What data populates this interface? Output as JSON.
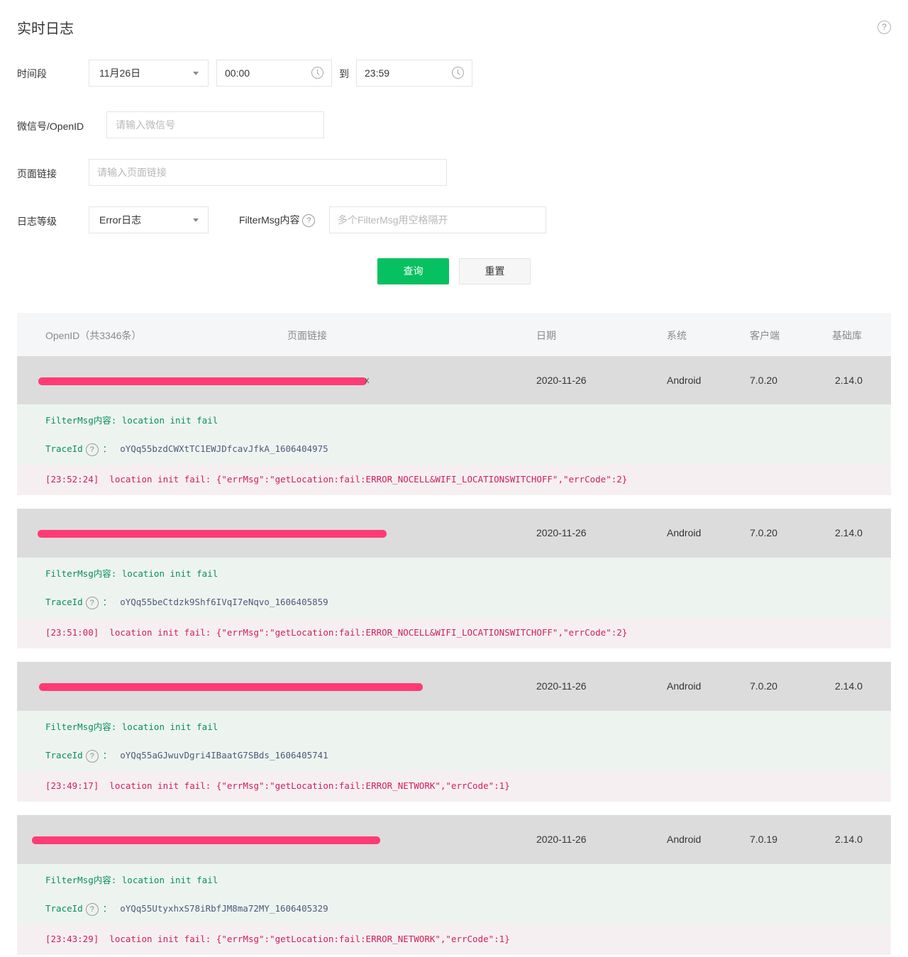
{
  "header": {
    "title": "实时日志",
    "help_icon": "question-circle-icon",
    "help_glyph": "?"
  },
  "filters": {
    "time_label": "时间段",
    "date_value": "11月26日",
    "start_time": "00:00",
    "to_label": "到",
    "end_time": "23:59",
    "wechat_label": "微信号/OpenID",
    "wechat_placeholder": "请输入微信号",
    "page_label": "页面链接",
    "page_placeholder": "请输入页面链接",
    "level_label": "日志等级",
    "level_value": "Error日志",
    "filtermsg_label": "FilterMsg内容",
    "filtermsg_placeholder": "多个FilterMsg用空格隔开",
    "query_button": "查询",
    "reset_button": "重置"
  },
  "table": {
    "columns": {
      "openid": "OpenID（共3346条）",
      "page": "页面链接",
      "date": "日期",
      "system": "系统",
      "client": "客户端",
      "lib": "基础库"
    },
    "trace_label": "TraceId",
    "trace_colon": "：",
    "rows": [
      {
        "openid_tail": "x",
        "date": "2020-11-26",
        "system": "Android",
        "client": "7.0.20",
        "lib": "2.14.0",
        "filter_msg": "FilterMsg内容: location init fail",
        "trace_id": "oYQq55bzdCWXtTC1EWJDfcavJfkA_1606404975",
        "log": "[23:52:24]  location init fail: {\"errMsg\":\"getLocation:fail:ERROR_NOCELL&WIFI_LOCATIONSWITCHOFF\",\"errCode\":2}"
      },
      {
        "openid_tail": "",
        "date": "2020-11-26",
        "system": "Android",
        "client": "7.0.20",
        "lib": "2.14.0",
        "filter_msg": "FilterMsg内容: location init fail",
        "trace_id": "oYQq55beCtdzk9Shf6IVqI7eNqvo_1606405859",
        "log": "[23:51:00]  location init fail: {\"errMsg\":\"getLocation:fail:ERROR_NOCELL&WIFI_LOCATIONSWITCHOFF\",\"errCode\":2}"
      },
      {
        "openid_tail": "",
        "date": "2020-11-26",
        "system": "Android",
        "client": "7.0.20",
        "lib": "2.14.0",
        "filter_msg": "FilterMsg内容: location init fail",
        "trace_id": "oYQq55aGJwuvDgri4IBaatG7SBds_1606405741",
        "log": "[23:49:17]  location init fail: {\"errMsg\":\"getLocation:fail:ERROR_NETWORK\",\"errCode\":1}"
      },
      {
        "openid_tail": "",
        "date": "2020-11-26",
        "system": "Android",
        "client": "7.0.19",
        "lib": "2.14.0",
        "filter_msg": "FilterMsg内容: location init fail",
        "trace_id": "oYQq55UtyxhxS78iRbfJM8ma72MY_1606405329",
        "log": "[23:43:29]  location init fail: {\"errMsg\":\"getLocation:fail:ERROR_NETWORK\",\"errCode\":1}"
      }
    ]
  },
  "colors": {
    "primary": "#07c160",
    "redaction": "#ff3b75",
    "log_error": "#d01f56",
    "filter_green": "#078f5e"
  }
}
